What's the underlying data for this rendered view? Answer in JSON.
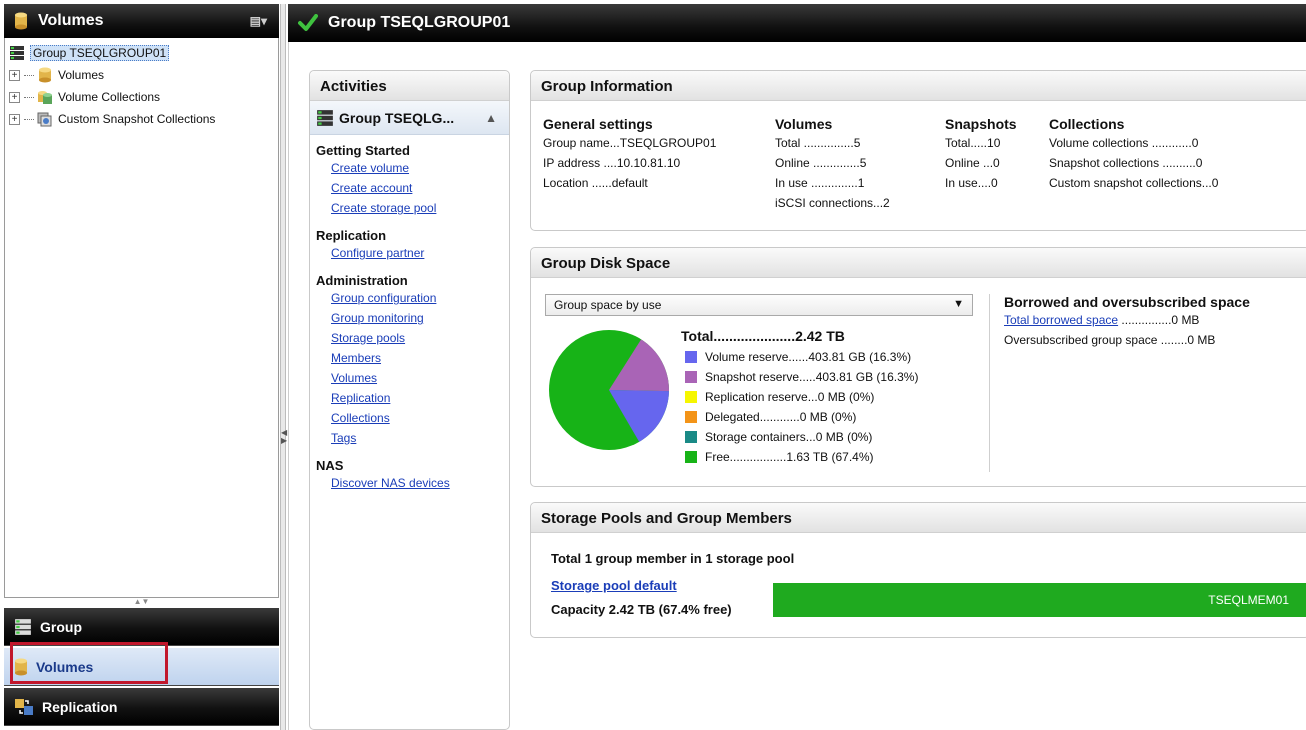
{
  "left": {
    "title": "Volumes",
    "tree": {
      "root": "Group TSEQLGROUP01",
      "children": [
        "Volumes",
        "Volume Collections",
        "Custom Snapshot Collections"
      ]
    },
    "nav": {
      "group": "Group",
      "volumes": "Volumes",
      "replication": "Replication"
    }
  },
  "main": {
    "title": "Group TSEQLGROUP01",
    "activities": {
      "title": "Activities",
      "group_label": "Group TSEQLG...",
      "sections": [
        {
          "heading": "Getting Started",
          "links": [
            "Create volume",
            "Create account",
            "Create storage pool"
          ]
        },
        {
          "heading": "Replication",
          "links": [
            "Configure partner"
          ]
        },
        {
          "heading": "Administration",
          "links": [
            "Group configuration",
            "Group monitoring",
            "Storage pools",
            "Members",
            "Volumes",
            "Replication",
            "Collections",
            "Tags"
          ]
        },
        {
          "heading": "NAS",
          "links": [
            "Discover NAS devices"
          ]
        }
      ]
    },
    "group_info": {
      "title": "Group Information",
      "general": {
        "heading": "General settings",
        "rows": [
          "Group name...TSEQLGROUP01",
          "IP address ....10.10.81.10",
          "Location ......default"
        ]
      },
      "volumes": {
        "heading": "Volumes",
        "rows": [
          "Total ...............5",
          "Online ..............5",
          "In use ..............1",
          "iSCSI connections...2"
        ]
      },
      "snapshots": {
        "heading": "Snapshots",
        "rows": [
          "Total.....10",
          "Online ...0",
          "In use....0"
        ]
      },
      "collections": {
        "heading": "Collections",
        "rows": [
          "Volume collections ............0",
          "Snapshot collections ..........0",
          "Custom snapshot collections...0"
        ]
      }
    },
    "disk_space": {
      "title": "Group Disk Space",
      "select_value": "Group space by use",
      "total": "Total.....................2.42 TB",
      "legend": [
        {
          "label": "Volume reserve......403.81 GB (16.3%)",
          "color": "#6666ee"
        },
        {
          "label": "Snapshot reserve.....403.81 GB (16.3%)",
          "color": "#a964b6"
        },
        {
          "label": "Replication reserve...0 MB (0%)",
          "color": "#f6f600"
        },
        {
          "label": "Delegated............0 MB (0%)",
          "color": "#f39418"
        },
        {
          "label": "Storage containers...0 MB (0%)",
          "color": "#1a8a86"
        },
        {
          "label": "Free.................1.63 TB (67.4%)",
          "color": "#17b317"
        }
      ],
      "pie_fractions": [
        0.163,
        0.163,
        0,
        0,
        0,
        0.674
      ],
      "borrowed": {
        "heading": "Borrowed and oversubscribed space",
        "link_label": "Total borrowed space",
        "link_value": "...............0 MB",
        "over_label": "Oversubscribed group space ........0 MB"
      }
    },
    "pools": {
      "title": "Storage Pools and Group Members",
      "total_text": "Total 1 group member in 1 storage pool",
      "pool_link": "Storage pool default",
      "capacity": "Capacity 2.42 TB (67.4% free)",
      "member": "TSEQLMEM01"
    }
  }
}
